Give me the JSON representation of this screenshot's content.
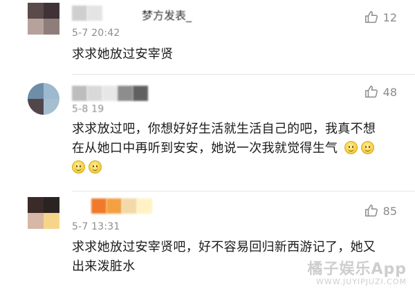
{
  "comments": [
    {
      "timestamp": "5-7 20:42",
      "name_fragment": "梦方发表_",
      "like_count": "12",
      "text": "求求她放过安宰贤",
      "avatar_colors": [
        "#5a4a4a",
        "#403338",
        "#b7a19c",
        "#8f7d7c"
      ],
      "name_blur_colors": [
        "#cfcfcf",
        "#e4e4e4"
      ]
    },
    {
      "timestamp": "5-8 19",
      "like_count": "48",
      "text": "求求放过吧，你想好好生活就生活自己的吧，我真不想在从她口中再听到安安，她说一次我就觉得生气",
      "emoji_count": 4,
      "avatar_colors": [
        "#6c8ea7",
        "#9db8cf",
        "#52464b",
        "#a6bfd0"
      ],
      "name_blur_colors": [
        "#bdbdbd",
        "#d9d9d9",
        "#e7e7e7",
        "#8d8d8d",
        "#606060"
      ]
    },
    {
      "timestamp": "5-7 13:31",
      "like_count": "85",
      "text": "求求她放过安宰贤吧，好不容易回归新西游记了，她又出来泼脏水",
      "avatar_colors": [
        "#3a2a28",
        "#2b2222",
        "#d7b7a6",
        "#f6d58b"
      ],
      "name_blur_colors": [
        "#f07a2a",
        "#f5a040",
        "#f4d9a8",
        "#fff2c4"
      ]
    }
  ],
  "watermark": {
    "main": "橘子娱乐App",
    "sub": "WWW.JUYIPJUZI.COM"
  },
  "icons": {
    "like": "thumbs-up-icon",
    "emoji": "smile-emoji-icon"
  },
  "colors": {
    "meta_text": "#8c8c8c",
    "divider": "#e6e6e6",
    "body_text": "#1a1a1a"
  }
}
